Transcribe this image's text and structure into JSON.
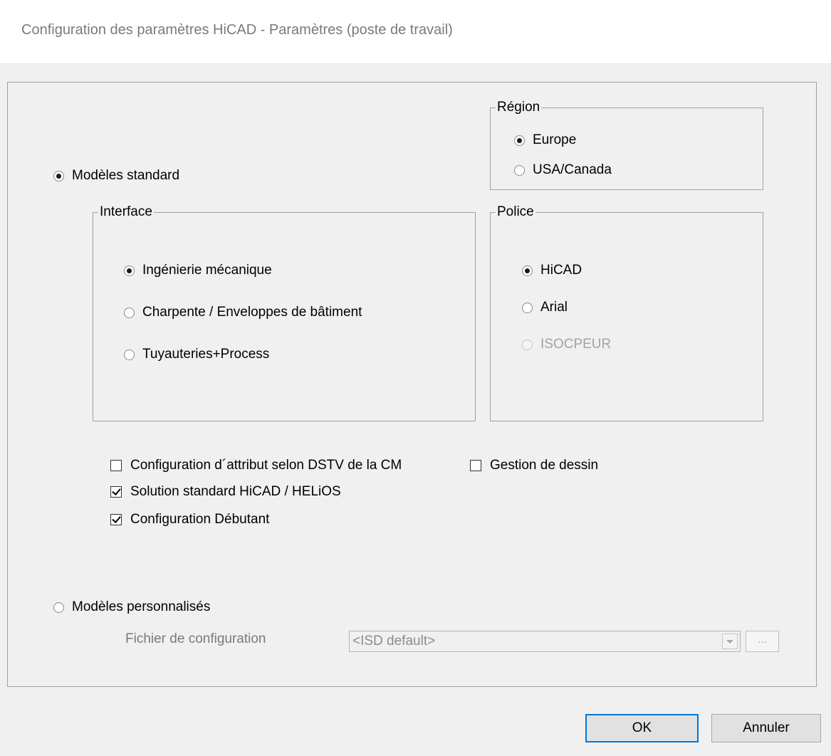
{
  "window": {
    "title": "Configuration des paramètres HiCAD - Paramètres (poste de travail)"
  },
  "templates": {
    "standard_label": "Modèles standard",
    "standard_selected": true,
    "custom_label": "Modèles personnalisés",
    "custom_selected": false
  },
  "region": {
    "label": "Région",
    "options": [
      {
        "label": "Europe",
        "selected": true
      },
      {
        "label": "USA/Canada",
        "selected": false
      }
    ]
  },
  "interface": {
    "label": "Interface",
    "options": [
      {
        "label": "Ingénierie mécanique",
        "selected": true
      },
      {
        "label": "Charpente / Enveloppes de bâtiment",
        "selected": false
      },
      {
        "label": "Tuyauteries+Process",
        "selected": false
      }
    ]
  },
  "police": {
    "label": "Police",
    "options": [
      {
        "label": "HiCAD",
        "selected": true,
        "enabled": true
      },
      {
        "label": "Arial",
        "selected": false,
        "enabled": true
      },
      {
        "label": "ISOCPEUR",
        "selected": false,
        "enabled": false
      }
    ]
  },
  "checkboxes": {
    "dstv": {
      "label": "Configuration d´attribut selon DSTV de la CM",
      "checked": false
    },
    "drawing_management": {
      "label": "Gestion de dessin",
      "checked": false
    },
    "helios": {
      "label": "Solution standard HiCAD / HELiOS",
      "checked": true
    },
    "beginner": {
      "label": "Configuration Débutant",
      "checked": true
    }
  },
  "config_file": {
    "label": "Fichier de configuration",
    "value": "<ISD default>",
    "browse_label": "..."
  },
  "buttons": {
    "ok": "OK",
    "cancel": "Annuler"
  }
}
